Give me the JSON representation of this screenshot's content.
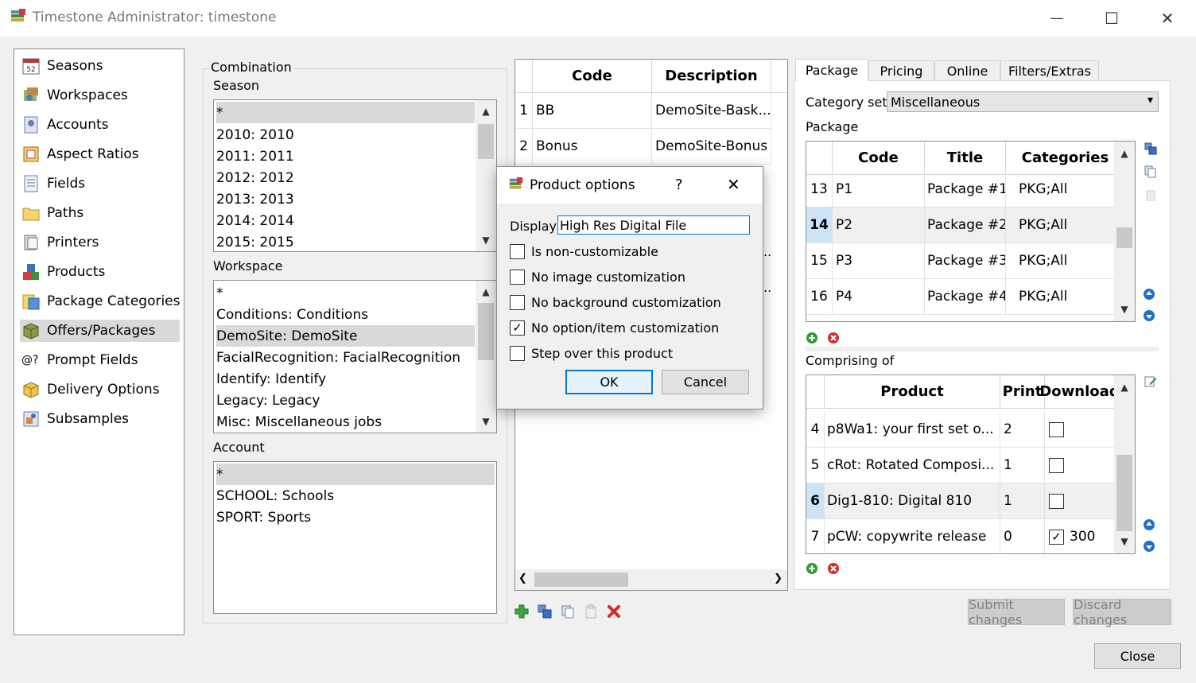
{
  "window": {
    "title": "Timestone Administrator: timestone",
    "minimize_glyph": "—",
    "maximize_glyph": "☐",
    "close_glyph": "✕"
  },
  "nav": {
    "items": [
      {
        "label": "Seasons",
        "icon": "calendar-icon"
      },
      {
        "label": "Workspaces",
        "icon": "workspace-icon"
      },
      {
        "label": "Accounts",
        "icon": "accounts-icon"
      },
      {
        "label": "Aspect Ratios",
        "icon": "aspect-ratio-icon"
      },
      {
        "label": "Fields",
        "icon": "fields-icon"
      },
      {
        "label": "Paths",
        "icon": "folder-icon"
      },
      {
        "label": "Printers",
        "icon": "printer-icon"
      },
      {
        "label": "Products",
        "icon": "products-icon"
      },
      {
        "label": "Package Categories",
        "icon": "package-category-icon"
      },
      {
        "label": "Offers/Packages",
        "icon": "package-icon"
      },
      {
        "label": "Prompt Fields",
        "icon": "prompt-field-icon"
      },
      {
        "label": "Delivery Options",
        "icon": "delivery-icon"
      },
      {
        "label": "Subsamples",
        "icon": "subsample-icon"
      }
    ],
    "prompt_icon_text": "@?",
    "selected_index": 9
  },
  "combination": {
    "group_label": "Combination",
    "season_label": "Season",
    "seasons": [
      "*",
      "2010: 2010",
      "2011: 2011",
      "2012: 2012",
      "2013: 2013",
      "2014: 2014",
      "2015: 2015"
    ],
    "workspace_label": "Workspace",
    "workspaces": [
      "*",
      "Conditions: Conditions",
      "DemoSite: DemoSite",
      "FacialRecognition: FacialRecognition",
      "Identify: Identify",
      "Legacy: Legacy",
      "Misc: Miscellaneous jobs"
    ],
    "account_label": "Account",
    "accounts": [
      "*",
      "SCHOOL: Schools",
      "SPORT: Sports"
    ]
  },
  "offers_grid": {
    "headers": [
      "Code",
      "Description"
    ],
    "rows": [
      {
        "num": "1",
        "code": "BB",
        "desc": "DemoSite-Bask..."
      },
      {
        "num": "2",
        "code": "Bonus",
        "desc": "DemoSite-Bonus"
      }
    ],
    "hidden_fragments": [
      "..",
      ".."
    ]
  },
  "tabs": [
    "Package",
    "Pricing",
    "Online",
    "Filters/Extras"
  ],
  "package_tab": {
    "category_set_label": "Category set:",
    "category_set_value": "Miscellaneous",
    "package_label": "Package",
    "package_headers": [
      "Code",
      "Title",
      "Categories"
    ],
    "packages": [
      {
        "num": "13",
        "code": "P1",
        "title": "Package #1",
        "cats": "PKG;All"
      },
      {
        "num": "14",
        "code": "P2",
        "title": "Package #2",
        "cats": "PKG;All"
      },
      {
        "num": "15",
        "code": "P3",
        "title": "Package #3",
        "cats": "PKG;All"
      },
      {
        "num": "16",
        "code": "P4",
        "title": "Package #4",
        "cats": "PKG;All"
      }
    ],
    "comprising_label": "Comprising of",
    "comprising_headers": [
      "Product",
      "Print",
      "Download"
    ],
    "items": [
      {
        "num": "4",
        "product": "p8Wa1: your first set o...",
        "print": "2",
        "download": false,
        "dl_value": ""
      },
      {
        "num": "5",
        "product": "cRot: Rotated Composi...",
        "print": "1",
        "download": false,
        "dl_value": ""
      },
      {
        "num": "6",
        "product": "Dig1-810: Digital 810",
        "print": "1",
        "download": false,
        "dl_value": ""
      },
      {
        "num": "7",
        "product": "pCW: copywrite release",
        "print": "0",
        "download": true,
        "dl_value": "300"
      }
    ]
  },
  "buttons": {
    "submit": "Submit changes",
    "discard": "Discard changes",
    "close": "Close"
  },
  "dialog": {
    "title": "Product options",
    "help": "?",
    "display_label": "Display",
    "display_value": "High Res Digital File",
    "options": [
      {
        "label": "Is non-customizable",
        "checked": false
      },
      {
        "label": "No image customization",
        "checked": false
      },
      {
        "label": "No background customization",
        "checked": false
      },
      {
        "label": "No option/item customization",
        "checked": true
      },
      {
        "label": "Step over this product",
        "checked": false
      }
    ],
    "ok": "OK",
    "cancel": "Cancel"
  },
  "glyphs": {
    "check": "✓",
    "up": "▲",
    "down": "▼",
    "left": "❮",
    "right": "❯",
    "combo_arrow": "▾"
  },
  "colors": {
    "selection": "#d9d9d9",
    "current_row": "#cce4f7",
    "accent": "#0078d7"
  }
}
